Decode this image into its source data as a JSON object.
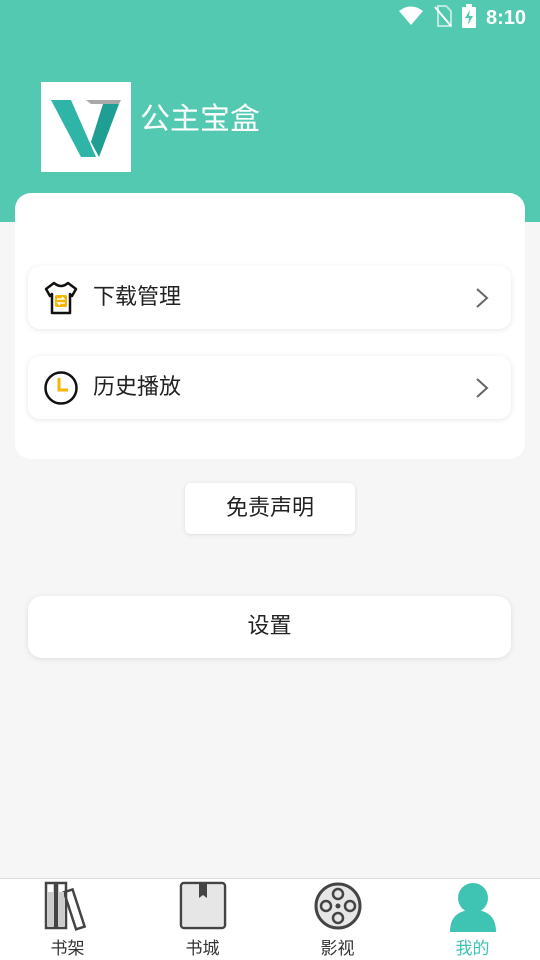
{
  "status_bar": {
    "time": "8:10"
  },
  "header": {
    "app_title": "公主宝盒"
  },
  "menu": {
    "items": [
      {
        "label": "下载管理",
        "icon": "download-shirt-icon"
      },
      {
        "label": "历史播放",
        "icon": "clock-icon"
      }
    ]
  },
  "buttons": {
    "disclaimer": "免责声明",
    "settings": "设置"
  },
  "bottom_nav": {
    "items": [
      {
        "label": "书架",
        "icon": "bookshelf-icon",
        "active": false
      },
      {
        "label": "书城",
        "icon": "book-icon",
        "active": false
      },
      {
        "label": "影视",
        "icon": "film-reel-icon",
        "active": false
      },
      {
        "label": "我的",
        "icon": "user-icon",
        "active": true
      }
    ]
  },
  "colors": {
    "header_bg": "#52c9b0",
    "active_tab": "#3fc4b4",
    "accent_orange": "#f4b400"
  }
}
